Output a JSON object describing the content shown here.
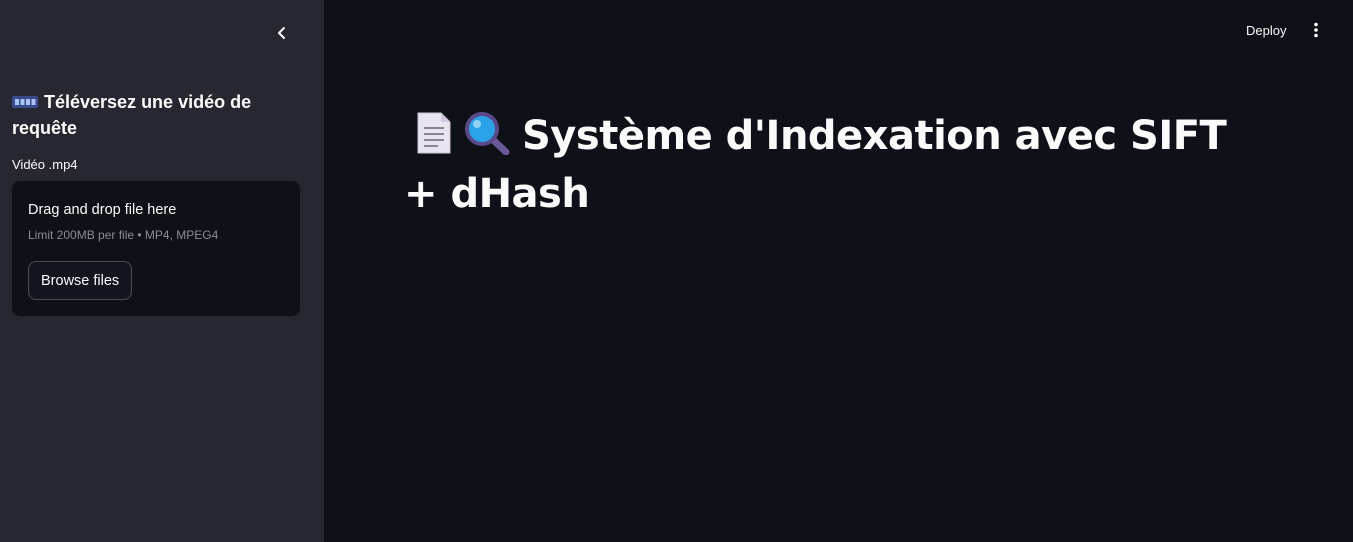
{
  "sidebar": {
    "header_text": "Téléversez une vidéo de requête",
    "uploader": {
      "label": "Vidéo .mp4",
      "dropzone_title": "Drag and drop file here",
      "dropzone_limit": "Limit 200MB per file • MP4, MPEG4",
      "browse_label": "Browse files"
    },
    "icons": {
      "collapse": "chevron-left-icon",
      "header": "film-frames-icon"
    }
  },
  "toolbar": {
    "deploy_label": "Deploy",
    "menu_icon": "kebab-menu-icon"
  },
  "main": {
    "title": "Système d'Indexation avec SIFT + dHash",
    "title_icons": [
      "page-document-icon",
      "magnifying-glass-icon"
    ]
  },
  "colors": {
    "app_background": "#0e1117",
    "sidebar_background": "#262730",
    "text": "#fafafa",
    "muted_text": "#8b8d97"
  }
}
